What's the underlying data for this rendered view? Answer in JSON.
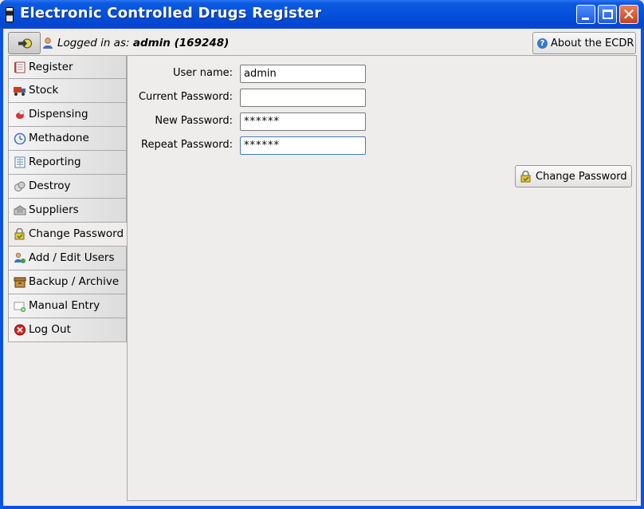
{
  "window": {
    "title": "Electronic Controlled Drugs Register",
    "controls": {
      "minimize": "minimize",
      "maximize": "maximize",
      "close": "✕"
    }
  },
  "header": {
    "logged_in_prefix": "Logged in as:",
    "user": "admin (169248)",
    "about_label": "About the ECDR"
  },
  "sidebar": {
    "items": [
      {
        "label": "Register",
        "icon": "register-icon",
        "active": false
      },
      {
        "label": "Stock",
        "icon": "stock-truck-icon",
        "active": false
      },
      {
        "label": "Dispensing",
        "icon": "dispensing-icon",
        "active": false
      },
      {
        "label": "Methadone",
        "icon": "methadone-icon",
        "active": false
      },
      {
        "label": "Reporting",
        "icon": "reporting-icon",
        "active": false
      },
      {
        "label": "Destroy",
        "icon": "destroy-icon",
        "active": false
      },
      {
        "label": "Suppliers",
        "icon": "suppliers-icon",
        "active": false
      },
      {
        "label": "Change Password",
        "icon": "change-password-icon",
        "active": true
      },
      {
        "label": "Add / Edit Users",
        "icon": "users-icon",
        "active": false
      },
      {
        "label": "Backup / Archive",
        "icon": "backup-icon",
        "active": false
      },
      {
        "label": "Manual Entry",
        "icon": "manual-entry-icon",
        "active": false
      },
      {
        "label": "Log Out",
        "icon": "logout-icon",
        "active": false
      }
    ]
  },
  "form": {
    "username_label": "User name:",
    "username_value": "admin",
    "current_password_label": "Current Password:",
    "current_password_value": "",
    "new_password_label": "New Password:",
    "new_password_value": "******",
    "repeat_password_label": "Repeat Password:",
    "repeat_password_value": "******",
    "submit_label": "Change Password"
  },
  "colors": {
    "titlebar": "#0550dc",
    "panel_bg": "#eeedeb",
    "nav_border": "#a9a9a9"
  }
}
